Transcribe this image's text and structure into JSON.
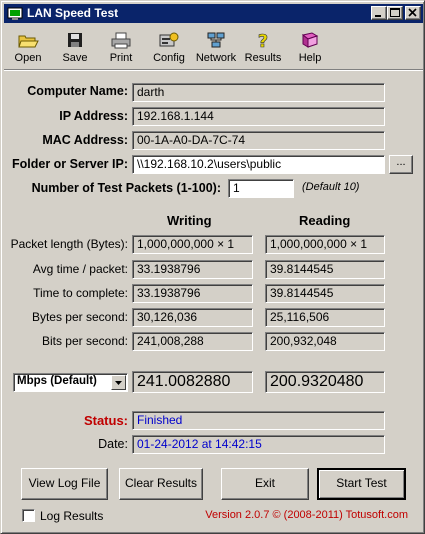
{
  "window": {
    "title": "LAN Speed Test"
  },
  "toolbar": {
    "items": [
      {
        "label": "Open",
        "icon": "folder-open-icon"
      },
      {
        "label": "Save",
        "icon": "floppy-disk-icon"
      },
      {
        "label": "Print",
        "icon": "printer-icon"
      },
      {
        "label": "Config",
        "icon": "config-icon"
      },
      {
        "label": "Network",
        "icon": "network-icon"
      },
      {
        "label": "Results",
        "icon": "question-icon"
      },
      {
        "label": "Help",
        "icon": "book-icon"
      }
    ]
  },
  "info": {
    "computer_name_label": "Computer Name:",
    "computer_name": "darth",
    "ip_label": "IP Address:",
    "ip": "192.168.1.144",
    "mac_label": "MAC Address:",
    "mac": "00-1A-A0-DA-7C-74",
    "folder_label": "Folder or Server IP:",
    "folder": "\\\\192.168.10.2\\users\\public",
    "browse_label": "...",
    "packets_label": "Number of Test Packets (1-100):",
    "packets": "1",
    "packets_hint": "(Default 10)"
  },
  "results": {
    "writing_header": "Writing",
    "reading_header": "Reading",
    "rows": [
      {
        "label": "Packet length (Bytes):",
        "writing": "1,000,000,000  × 1",
        "reading": "1,000,000,000  × 1"
      },
      {
        "label": "Avg time / packet:",
        "writing": "33.1938796",
        "reading": "39.8144545"
      },
      {
        "label": "Time to complete:",
        "writing": "33.1938796",
        "reading": "39.8144545"
      },
      {
        "label": "Bytes per second:",
        "writing": "30,126,036",
        "reading": "25,116,506"
      },
      {
        "label": "Bits per second:",
        "writing": "241,008,288",
        "reading": "200,932,048"
      }
    ],
    "unit_select": "Mbps (Default)",
    "writing_total": "241.0082880",
    "reading_total": "200.9320480"
  },
  "status": {
    "status_label": "Status:",
    "status_value": "Finished",
    "date_label": "Date:",
    "date_value": "01-24-2012 at 14:42:15"
  },
  "buttons": {
    "view_log": "View Log File",
    "clear": "Clear Results",
    "exit": "Exit",
    "start": "Start Test"
  },
  "footer": {
    "log_results_label": "Log Results",
    "version": "Version 2.0.7  © (2008-2011) Totusoft.com"
  },
  "colors": {
    "titlebar": "#0a246a",
    "status_label": "#c00000",
    "value_text": "#0000cc",
    "version_text": "#c00000"
  }
}
